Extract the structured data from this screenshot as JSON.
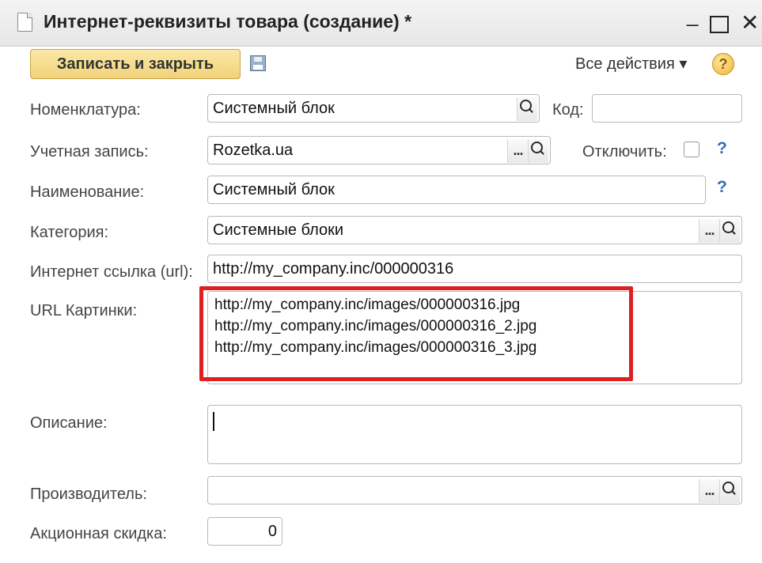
{
  "window": {
    "title": "Интернет-реквизиты товара (создание) *",
    "title_bar_controls": [
      "minimize-icon",
      "maximize-icon",
      "close-icon"
    ]
  },
  "toolbar": {
    "save_close_label": "Записать и закрыть",
    "save_icon": "floppy-disk-icon",
    "all_actions_label": "Все действия ▾",
    "help_label": "?"
  },
  "form": {
    "nomenclature": {
      "label": "Номенклатура:",
      "value": "Системный блок"
    },
    "code": {
      "label": "Код:",
      "value": ""
    },
    "account": {
      "label": "Учетная запись:",
      "value": "Rozetka.ua"
    },
    "disable": {
      "label": "Отключить:",
      "checked": false
    },
    "name": {
      "label": "Наименование:",
      "value": "Системный блок"
    },
    "category": {
      "label": "Категория:",
      "value": "Системные блоки"
    },
    "url": {
      "label": "Интернет ссылка (url):",
      "value": "http://my_company.inc/000000316"
    },
    "image_urls": {
      "label": "URL Картинки:",
      "lines": [
        "http://my_company.inc/images/000000316.jpg",
        "http://my_company.inc/images/000000316_2.jpg",
        "http://my_company.inc/images/000000316_3.jpg"
      ]
    },
    "description": {
      "label": "Описание:",
      "value": ""
    },
    "manufacturer": {
      "label": "Производитель:",
      "value": ""
    },
    "discount": {
      "label": "Акционная скидка:",
      "value": "0"
    },
    "select_button": "...",
    "question_mark": "?"
  },
  "colors": {
    "highlight_border": "#e02020",
    "primary_button": "#f1d27a",
    "help_blue": "#2f6ebd"
  }
}
